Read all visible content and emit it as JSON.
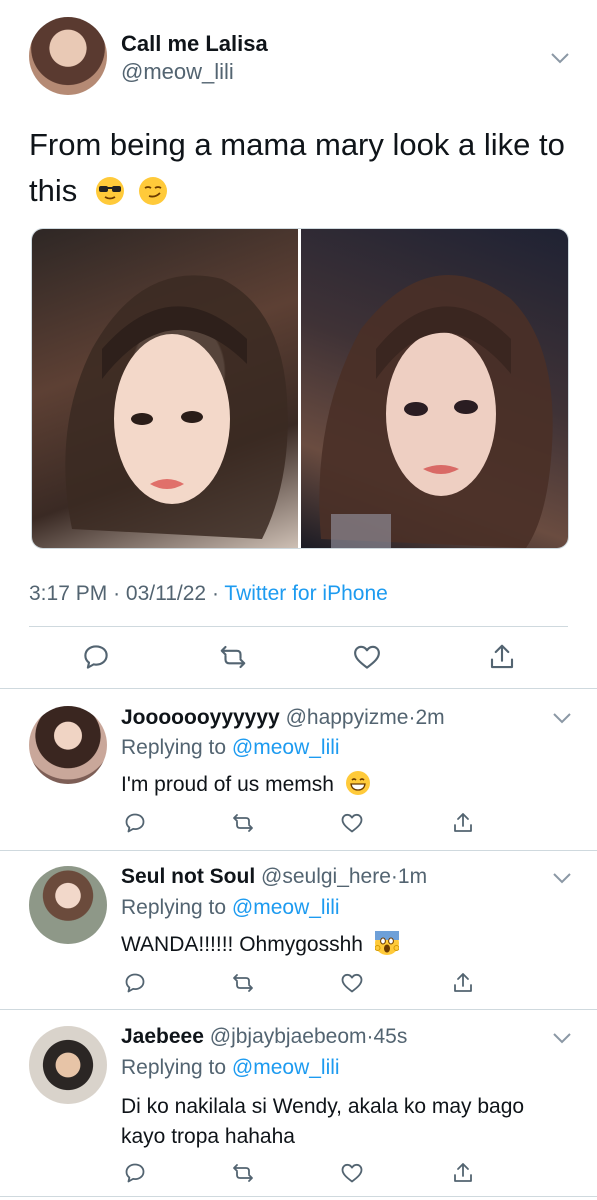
{
  "main_tweet": {
    "display_name": "Call me Lalisa",
    "handle": "@meow_lili",
    "text_line1": "From being a mama mary look a like to",
    "text_line2": "this",
    "time": "3:17 PM",
    "date": "03/11/22",
    "source": "Twitter for iPhone",
    "separator": "·",
    "emojis": [
      "sunglasses-emoji",
      "smirk-emoji"
    ]
  },
  "replies": [
    {
      "display_name": "Jooooooyyyyyy",
      "handle": "@happyizme",
      "age": "2m",
      "replying_prefix": "Replying to",
      "replying_to": "@meow_lili",
      "text": "I'm proud of us memsh",
      "emoji": "grinning-emoji"
    },
    {
      "display_name": "Seul not Soul",
      "handle": "@seulgi_here",
      "age": "1m",
      "replying_prefix": "Replying to",
      "replying_to": "@meow_lili",
      "text": "WANDA!!!!!! Ohmygosshh",
      "emoji": "screaming-emoji"
    },
    {
      "display_name": "Jaebeee",
      "handle": "@jbjaybjaebeom",
      "age": "45s",
      "replying_prefix": "Replying to",
      "replying_to": "@meow_lili",
      "text_line1": "Di ko nakilala si Wendy, akala ko may bago",
      "text_line2": "kayo tropa hahaha"
    }
  ],
  "separator": "·",
  "colors": {
    "link": "#1d9bf0",
    "muted": "#536471",
    "divider": "#cfd9de",
    "text": "#0f1419"
  }
}
